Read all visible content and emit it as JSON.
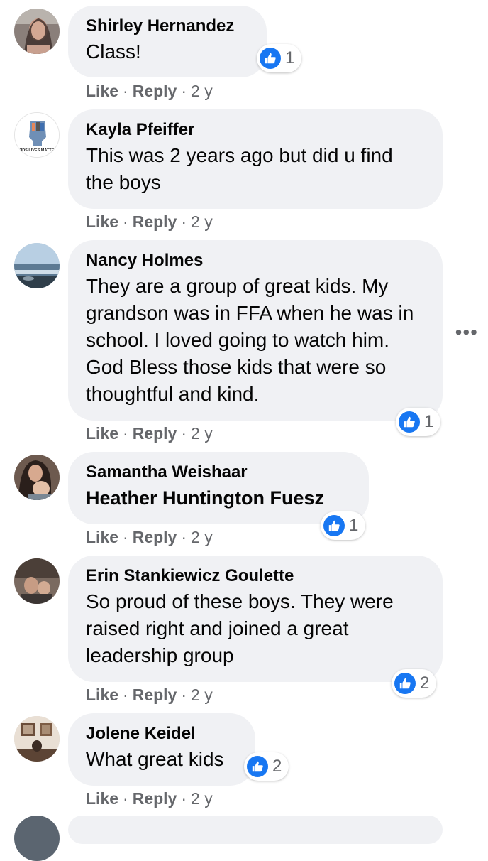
{
  "comments": [
    {
      "author": "Shirley Hernandez",
      "text": "Class!",
      "like": "Like",
      "reply": "Reply",
      "age": "2 y",
      "reactions": "1"
    },
    {
      "author": "Kayla Pfeiffer",
      "text": "This was 2 years ago but did u find the boys",
      "like": "Like",
      "reply": "Reply",
      "age": "2 y",
      "avatar_text": "KIDS LIVES MATTER"
    },
    {
      "author": "Nancy Holmes",
      "text": "They are a group of great kids. My grandson was in FFA when he was in school. I loved going to watch him. God Bless those kids that were so thoughtful and kind.",
      "like": "Like",
      "reply": "Reply",
      "age": "2 y",
      "reactions": "1"
    },
    {
      "author": "Samantha Weishaar",
      "text": "Heather Huntington Fuesz",
      "like": "Like",
      "reply": "Reply",
      "age": "2 y",
      "reactions": "1"
    },
    {
      "author": "Erin Stankiewicz Goulette",
      "text": "So proud of these boys. They were raised right and joined a great leadership group",
      "like": "Like",
      "reply": "Reply",
      "age": "2 y",
      "reactions": "2"
    },
    {
      "author": "Jolene Keidel",
      "text": "What great kids",
      "like": "Like",
      "reply": "Reply",
      "age": "2 y",
      "reactions": "2"
    }
  ],
  "icons": {
    "reaction": "like-thumb-icon",
    "more": "more-options-icon"
  },
  "colors": {
    "bubble": "#f0f1f4",
    "like_blue": "#1877f2",
    "meta_gray": "#65676b"
  },
  "separator": "·",
  "more_glyph": "•••"
}
